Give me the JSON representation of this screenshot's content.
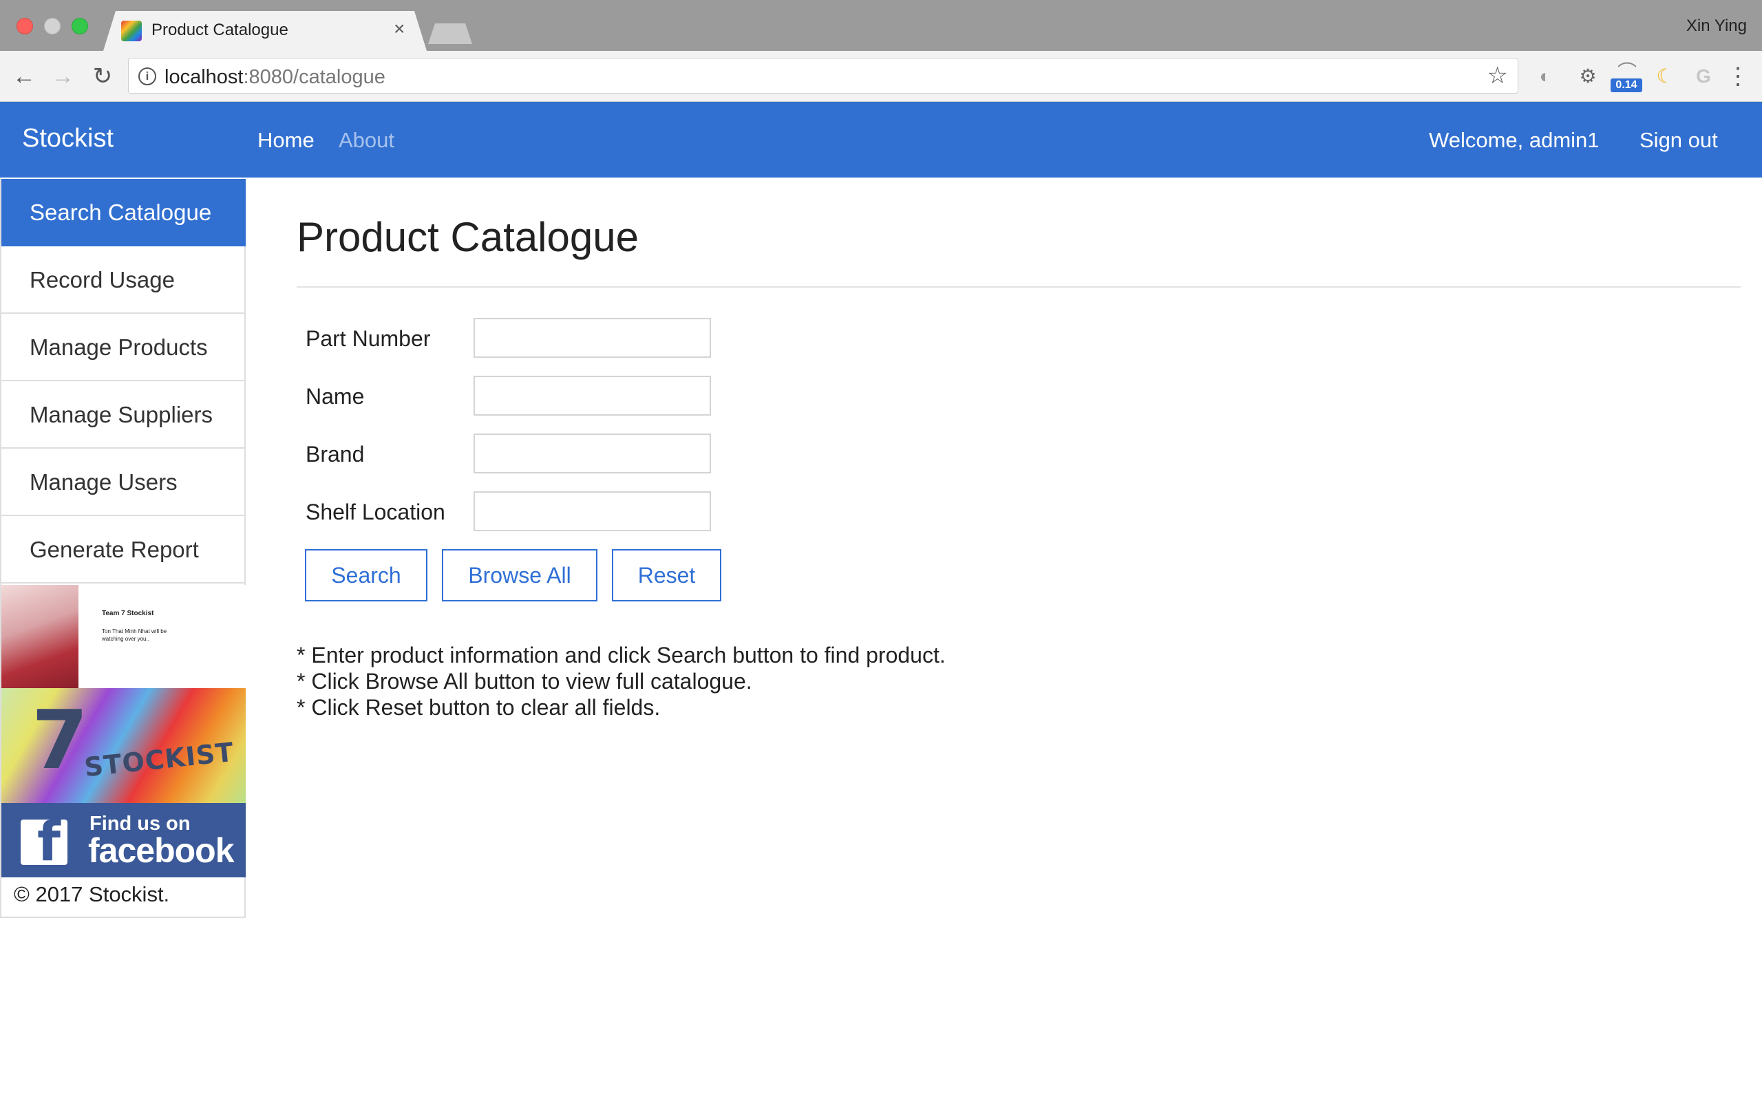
{
  "browser": {
    "tab_title": "Product Catalogue",
    "tab_close": "×",
    "profile_name": "Xin Ying",
    "url_host": "localhost",
    "url_path": ":8080/catalogue",
    "extension_badge": "0.14"
  },
  "navbar": {
    "brand": "Stockist",
    "links": [
      "Home",
      "About"
    ],
    "welcome": "Welcome, admin1",
    "sign_out": "Sign out",
    "color": "#3170d1"
  },
  "sidebar": {
    "items": [
      {
        "label": "Search Catalogue",
        "active": true
      },
      {
        "label": "Record Usage",
        "active": false
      },
      {
        "label": "Manage Products",
        "active": false
      },
      {
        "label": "Manage Suppliers",
        "active": false
      },
      {
        "label": "Manage Users",
        "active": false
      },
      {
        "label": "Generate Report",
        "active": false
      }
    ],
    "promo_title": "Team 7 Stockist",
    "promo_caption": "Ton That Minh Nhat will be watching over you..",
    "logo_number": "7",
    "logo_word": "STOCKIST",
    "facebook_line1": "Find us on",
    "facebook_line2": "facebook",
    "copyright": "© 2017 Stockist."
  },
  "main": {
    "title": "Product Catalogue",
    "fields": [
      {
        "label": "Part Number",
        "value": ""
      },
      {
        "label": "Name",
        "value": ""
      },
      {
        "label": "Brand",
        "value": ""
      },
      {
        "label": "Shelf Location",
        "value": ""
      }
    ],
    "buttons": {
      "search": "Search",
      "browse_all": "Browse All",
      "reset": "Reset"
    },
    "help": [
      "* Enter product information and click Search button to find product.",
      "* Click Browse All button to view full catalogue.",
      "* Click Reset button to clear all fields."
    ]
  },
  "icons": [
    "back-arrow-icon",
    "forward-arrow-icon",
    "reload-icon",
    "info-icon",
    "star-icon",
    "facebook-icon"
  ]
}
